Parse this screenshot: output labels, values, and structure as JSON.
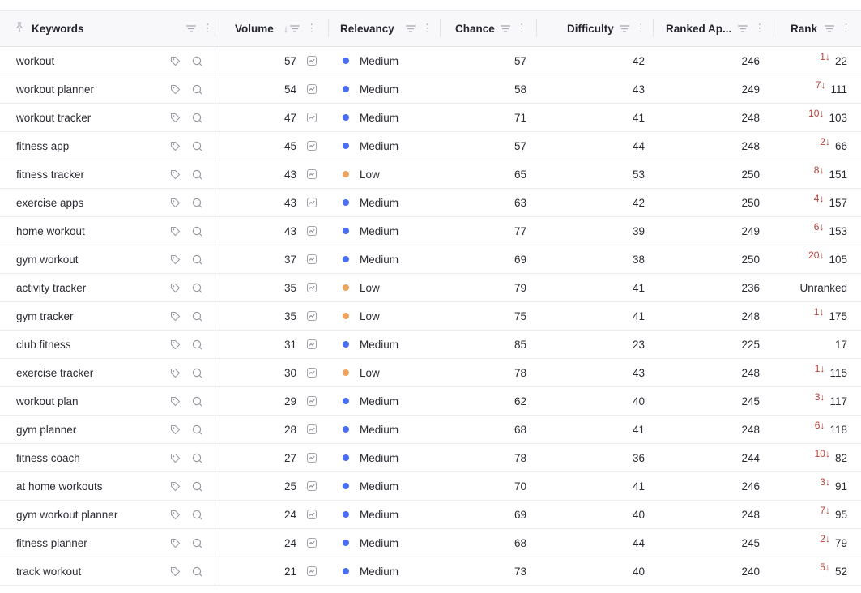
{
  "header": {
    "keywords": "Keywords",
    "volume": "Volume",
    "relevancy": "Relevancy",
    "chance": "Chance",
    "difficulty": "Difficulty",
    "ranked_apps": "Ranked Ap...",
    "rank": "Rank",
    "pin_icon": "pin-icon",
    "filter_icon": "filter-icon",
    "kebab_icon": "kebab-icon",
    "sort_icon": "sort-descending-icon"
  },
  "colors": {
    "medium": "#4a6ef5",
    "low": "#f0a35c",
    "rank_change": "#b9413a"
  },
  "rows": [
    {
      "keyword": "workout",
      "volume": "57",
      "relevancy": "Medium",
      "level": "medium",
      "chance": "57",
      "difficulty": "42",
      "ranked_apps": "246",
      "change": "1↓",
      "rank": "22"
    },
    {
      "keyword": "workout planner",
      "volume": "54",
      "relevancy": "Medium",
      "level": "medium",
      "chance": "58",
      "difficulty": "43",
      "ranked_apps": "249",
      "change": "7↓",
      "rank": "111"
    },
    {
      "keyword": "workout tracker",
      "volume": "47",
      "relevancy": "Medium",
      "level": "medium",
      "chance": "71",
      "difficulty": "41",
      "ranked_apps": "248",
      "change": "10↓",
      "rank": "103"
    },
    {
      "keyword": "fitness app",
      "volume": "45",
      "relevancy": "Medium",
      "level": "medium",
      "chance": "57",
      "difficulty": "44",
      "ranked_apps": "248",
      "change": "2↓",
      "rank": "66"
    },
    {
      "keyword": "fitness tracker",
      "volume": "43",
      "relevancy": "Low",
      "level": "low",
      "chance": "65",
      "difficulty": "53",
      "ranked_apps": "250",
      "change": "8↓",
      "rank": "151"
    },
    {
      "keyword": "exercise apps",
      "volume": "43",
      "relevancy": "Medium",
      "level": "medium",
      "chance": "63",
      "difficulty": "42",
      "ranked_apps": "250",
      "change": "4↓",
      "rank": "157"
    },
    {
      "keyword": "home workout",
      "volume": "43",
      "relevancy": "Medium",
      "level": "medium",
      "chance": "77",
      "difficulty": "39",
      "ranked_apps": "249",
      "change": "6↓",
      "rank": "153"
    },
    {
      "keyword": "gym workout",
      "volume": "37",
      "relevancy": "Medium",
      "level": "medium",
      "chance": "69",
      "difficulty": "38",
      "ranked_apps": "250",
      "change": "20↓",
      "rank": "105"
    },
    {
      "keyword": "activity tracker",
      "volume": "35",
      "relevancy": "Low",
      "level": "low",
      "chance": "79",
      "difficulty": "41",
      "ranked_apps": "236",
      "change": "",
      "rank": "Unranked"
    },
    {
      "keyword": "gym tracker",
      "volume": "35",
      "relevancy": "Low",
      "level": "low",
      "chance": "75",
      "difficulty": "41",
      "ranked_apps": "248",
      "change": "1↓",
      "rank": "175"
    },
    {
      "keyword": "club fitness",
      "volume": "31",
      "relevancy": "Medium",
      "level": "medium",
      "chance": "85",
      "difficulty": "23",
      "ranked_apps": "225",
      "change": "",
      "rank": "17"
    },
    {
      "keyword": "exercise tracker",
      "volume": "30",
      "relevancy": "Low",
      "level": "low",
      "chance": "78",
      "difficulty": "43",
      "ranked_apps": "248",
      "change": "1↓",
      "rank": "115"
    },
    {
      "keyword": "workout plan",
      "volume": "29",
      "relevancy": "Medium",
      "level": "medium",
      "chance": "62",
      "difficulty": "40",
      "ranked_apps": "245",
      "change": "3↓",
      "rank": "117"
    },
    {
      "keyword": "gym planner",
      "volume": "28",
      "relevancy": "Medium",
      "level": "medium",
      "chance": "68",
      "difficulty": "41",
      "ranked_apps": "248",
      "change": "6↓",
      "rank": "118"
    },
    {
      "keyword": "fitness coach",
      "volume": "27",
      "relevancy": "Medium",
      "level": "medium",
      "chance": "78",
      "difficulty": "36",
      "ranked_apps": "244",
      "change": "10↓",
      "rank": "82"
    },
    {
      "keyword": "at home workouts",
      "volume": "25",
      "relevancy": "Medium",
      "level": "medium",
      "chance": "70",
      "difficulty": "41",
      "ranked_apps": "246",
      "change": "3↓",
      "rank": "91"
    },
    {
      "keyword": "gym workout planner",
      "volume": "24",
      "relevancy": "Medium",
      "level": "medium",
      "chance": "69",
      "difficulty": "40",
      "ranked_apps": "248",
      "change": "7↓",
      "rank": "95"
    },
    {
      "keyword": "fitness planner",
      "volume": "24",
      "relevancy": "Medium",
      "level": "medium",
      "chance": "68",
      "difficulty": "44",
      "ranked_apps": "245",
      "change": "2↓",
      "rank": "79"
    },
    {
      "keyword": "track workout",
      "volume": "21",
      "relevancy": "Medium",
      "level": "medium",
      "chance": "73",
      "difficulty": "40",
      "ranked_apps": "240",
      "change": "5↓",
      "rank": "52"
    }
  ]
}
